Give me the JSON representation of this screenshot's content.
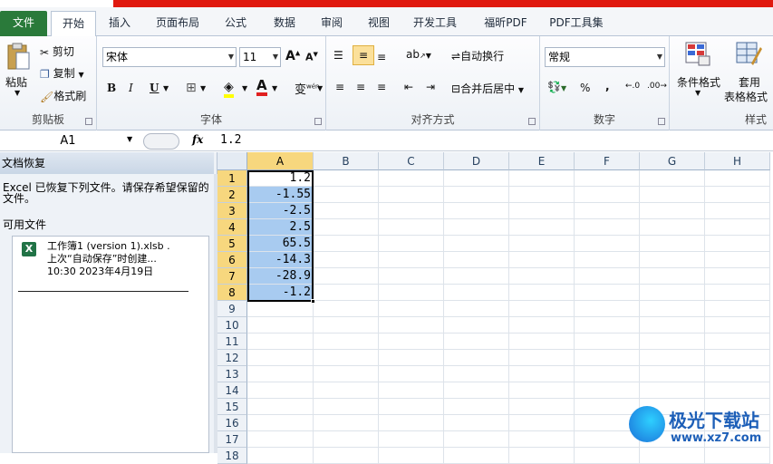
{
  "tabs": {
    "file": "文件",
    "items": [
      "开始",
      "插入",
      "页面布局",
      "公式",
      "数据",
      "审阅",
      "视图",
      "开发工具",
      "福昕PDF",
      "PDF工具集"
    ]
  },
  "clipboard": {
    "paste": "粘贴",
    "cut": "剪切",
    "copy": "复制",
    "format_painter": "格式刷",
    "label": "剪贴板"
  },
  "font": {
    "name": "宋体",
    "size": "11",
    "label": "字体",
    "bold": "B",
    "italic": "I",
    "underline": "U",
    "fontcolor": "A",
    "grow": "A",
    "shrink": "A"
  },
  "alignment": {
    "wrap": "自动换行",
    "merge": "合并后居中",
    "label": "对齐方式"
  },
  "number": {
    "format": "常规",
    "label": "数字",
    "percent": "%",
    "comma": ","
  },
  "styles": {
    "conditional": "条件格式",
    "table_format_1": "套用",
    "table_format_2": "表格格式",
    "label": "样式"
  },
  "formula_bar": {
    "name_box": "A1",
    "fx": "fx",
    "value": "1.2"
  },
  "recovery": {
    "title": "文档恢复",
    "message": "Excel 已恢复下列文件。请保存希望保留的文件。",
    "available": "可用文件",
    "file_name": "工作簿1 (version 1).xlsb .",
    "file_desc": "上次“自动保存”时创建...",
    "file_time": "10:30 2023年4月19日"
  },
  "sheet": {
    "columns": [
      "A",
      "B",
      "C",
      "D",
      "E",
      "F",
      "G",
      "H"
    ],
    "rows": [
      "1",
      "2",
      "3",
      "4",
      "5",
      "6",
      "7",
      "8",
      "9",
      "10",
      "11",
      "12",
      "13",
      "14",
      "15",
      "16",
      "17",
      "18"
    ],
    "colA": [
      "1.2",
      "-1.55",
      "-2.5",
      "2.5",
      "65.5",
      "-14.3",
      "-28.9",
      "-1.2"
    ]
  },
  "watermark": {
    "text": "极光下载站",
    "url": "www.xz7.com"
  },
  "colors": {
    "file_tab": "#2a7a3a",
    "selection": "#a8cbf0",
    "header_sel": "#f7d77e",
    "title_red": "#e0190f"
  }
}
